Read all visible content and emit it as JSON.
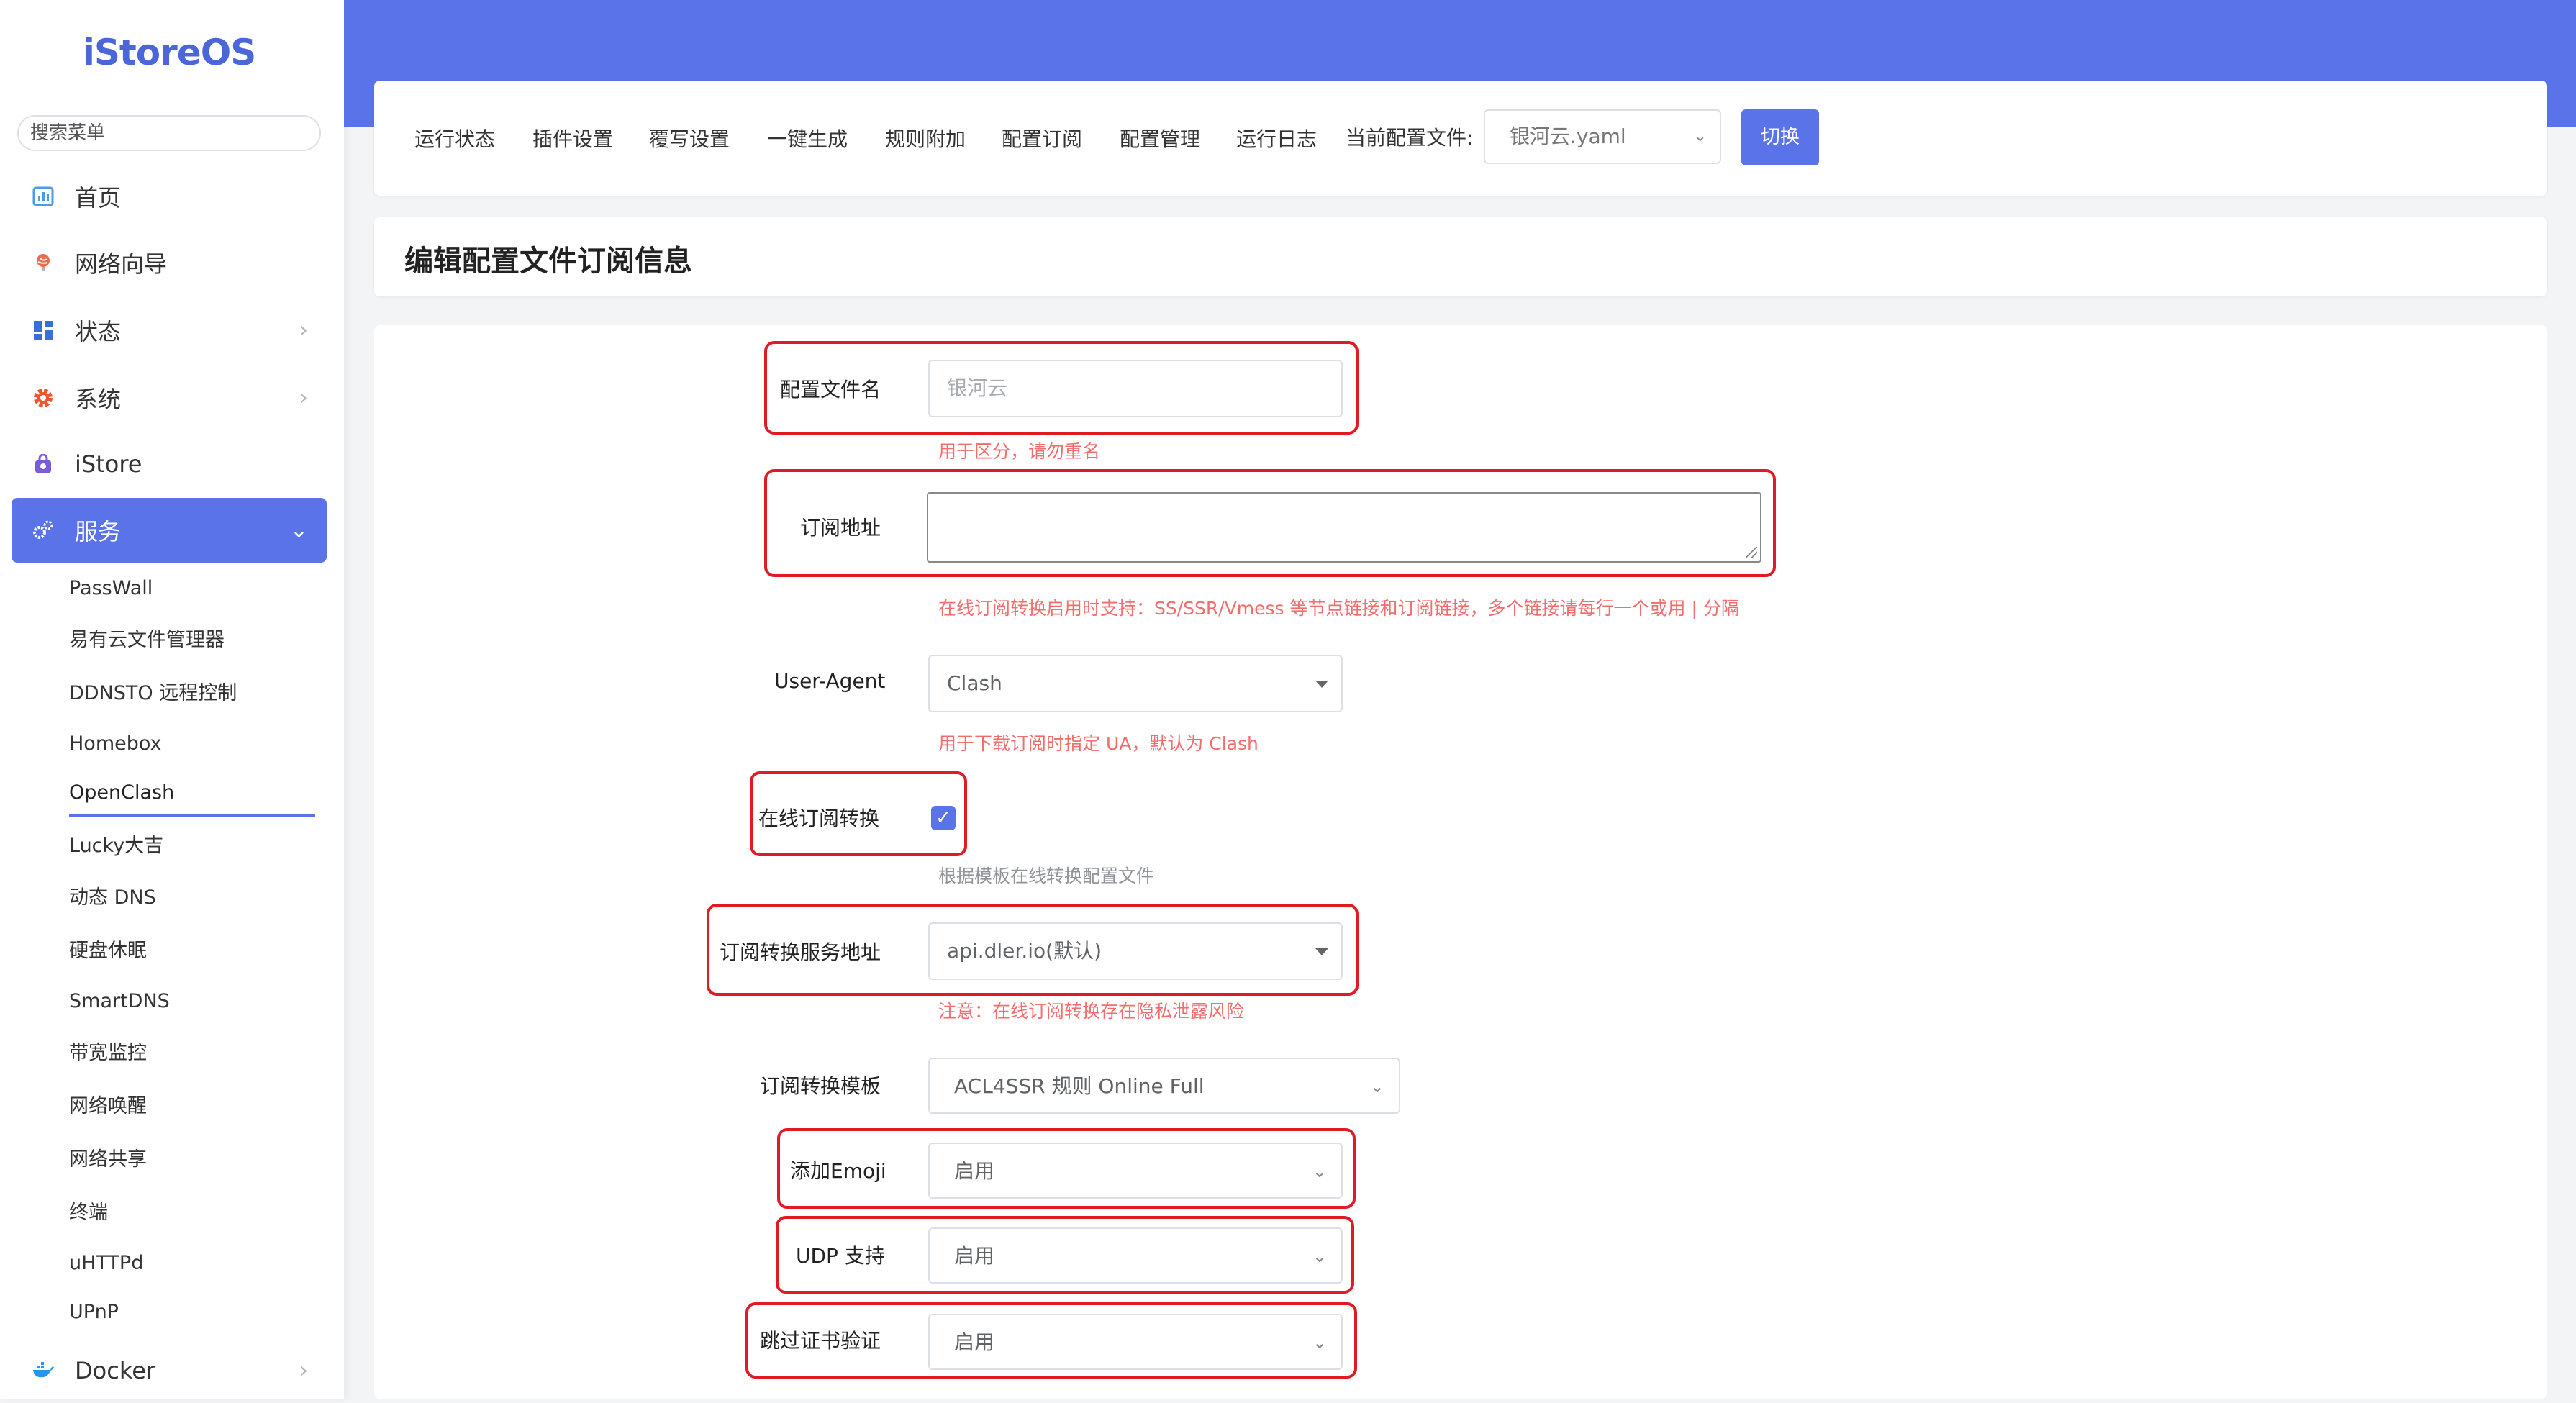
{
  "sidebar": {
    "logo": "iStoreOS",
    "search_placeholder": "搜索菜单",
    "items": [
      {
        "label": "首页"
      },
      {
        "label": "网络向导"
      },
      {
        "label": "状态"
      },
      {
        "label": "系统"
      },
      {
        "label": "iStore"
      },
      {
        "label": "服务"
      }
    ],
    "sub_items": [
      "PassWall",
      "易有云文件管理器",
      "DDNSTO 远程控制",
      "Homebox",
      "OpenClash",
      "Lucky大吉",
      "动态 DNS",
      "硬盘休眠",
      "SmartDNS",
      "带宽监控",
      "网络唤醒",
      "网络共享",
      "终端",
      "uHTTPd",
      "UPnP"
    ],
    "docker": "Docker",
    "active_sub": "OpenClash"
  },
  "tabs": [
    "运行状态",
    "插件设置",
    "覆写设置",
    "一键生成",
    "规则附加",
    "配置订阅",
    "配置管理",
    "运行日志"
  ],
  "current_config": {
    "label": "当前配置文件:",
    "value": "银河云.yaml",
    "switch_label": "切换"
  },
  "page_title": "编辑配置文件订阅信息",
  "form": {
    "config_name": {
      "label": "配置文件名",
      "placeholder": "银河云",
      "hint": "用于区分，请勿重名"
    },
    "sub_url": {
      "label": "订阅地址",
      "value": "",
      "hint": "在线订阅转换启用时支持：SS/SSR/Vmess 等节点链接和订阅链接，多个链接请每行一个或用 | 分隔"
    },
    "user_agent": {
      "label": "User-Agent",
      "value": "Clash",
      "hint": "用于下载订阅时指定 UA，默认为 Clash"
    },
    "online_convert": {
      "label": "在线订阅转换",
      "checked": true,
      "hint": "根据模板在线转换配置文件"
    },
    "convert_server": {
      "label": "订阅转换服务地址",
      "value": "api.dler.io(默认)",
      "hint": "注意：在线订阅转换存在隐私泄露风险"
    },
    "convert_template": {
      "label": "订阅转换模板",
      "value": "ACL4SSR 规则 Online Full"
    },
    "emoji": {
      "label": "添加Emoji",
      "value": "启用"
    },
    "udp": {
      "label": "UDP 支持",
      "value": "启用"
    },
    "skip_cert": {
      "label": "跳过证书验证",
      "value": "启用"
    }
  },
  "colors": {
    "accent": "#5b73e8",
    "highlight_box": "#e01b24",
    "hint_red": "#f56c6c"
  }
}
